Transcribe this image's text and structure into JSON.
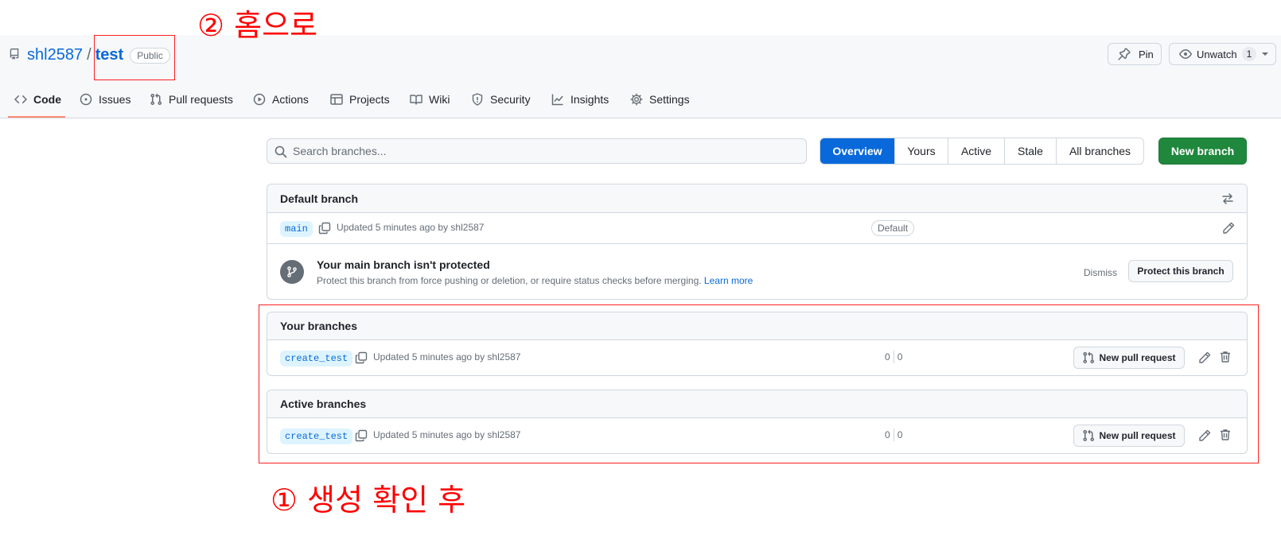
{
  "repo": {
    "owner": "shl2587",
    "separator": "/",
    "name": "test",
    "visibility": "Public",
    "pin_label": "Pin",
    "watch_label": "Unwatch",
    "watch_count": "1"
  },
  "tabs": [
    {
      "label": "Code",
      "icon": "code-icon"
    },
    {
      "label": "Issues",
      "icon": "issue-icon"
    },
    {
      "label": "Pull requests",
      "icon": "pull-request-icon"
    },
    {
      "label": "Actions",
      "icon": "play-icon"
    },
    {
      "label": "Projects",
      "icon": "table-icon"
    },
    {
      "label": "Wiki",
      "icon": "book-icon"
    },
    {
      "label": "Security",
      "icon": "shield-icon"
    },
    {
      "label": "Insights",
      "icon": "graph-icon"
    },
    {
      "label": "Settings",
      "icon": "gear-icon"
    }
  ],
  "search": {
    "placeholder": "Search branches..."
  },
  "filters": [
    "Overview",
    "Yours",
    "Active",
    "Stale",
    "All branches"
  ],
  "new_branch_label": "New branch",
  "default_branch": {
    "header": "Default branch",
    "branch": "main",
    "updated": "Updated 5 minutes ago by shl2587",
    "badge": "Default"
  },
  "protection": {
    "title": "Your main branch isn't protected",
    "desc": "Protect this branch from force pushing or deletion, or require status checks before merging.",
    "learn_more": "Learn more",
    "dismiss": "Dismiss",
    "protect_button": "Protect this branch"
  },
  "your_branches": {
    "header": "Your branches",
    "branch": "create_test",
    "updated": "Updated 5 minutes ago by shl2587",
    "behind": "0",
    "ahead": "0",
    "pr_button": "New pull request"
  },
  "active_branches": {
    "header": "Active branches",
    "branch": "create_test",
    "updated": "Updated 5 minutes ago by shl2587",
    "behind": "0",
    "ahead": "0",
    "pr_button": "New pull request"
  },
  "annotations": {
    "step2": "② 홈으로",
    "step1": "① 생성 확인 후",
    "color": "#ff0000"
  },
  "colors": {
    "accent": "#0969da",
    "primary_button": "#1f883d",
    "tab_underline": "#fd8c73"
  }
}
